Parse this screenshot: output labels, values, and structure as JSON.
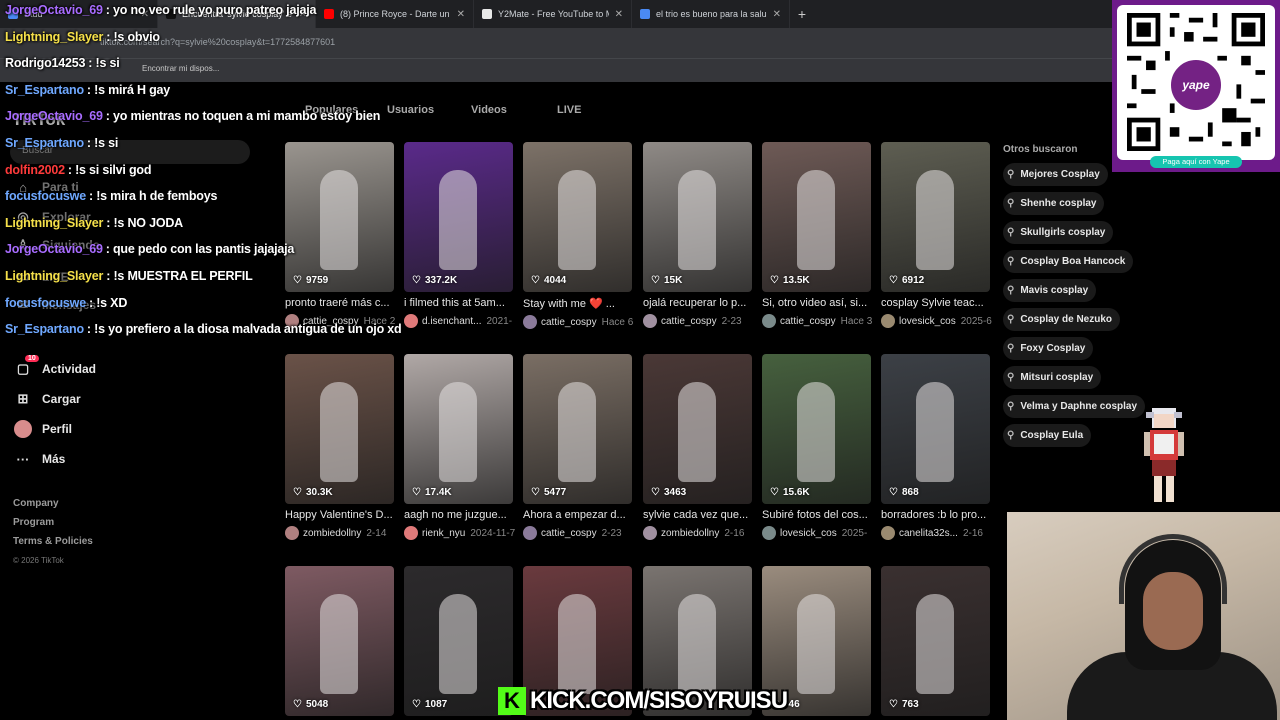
{
  "browser": {
    "tabs": [
      {
        "title": "Stud",
        "color": "#4a8af4",
        "active": false
      },
      {
        "title": "Encuentra 'sylvie cosplay' e",
        "color": "#111111",
        "active": true
      },
      {
        "title": "(8) Prince Royce - Darte un Beso",
        "color": "#ff0000",
        "active": false
      },
      {
        "title": "Y2Mate - Free YouTube to MP3",
        "color": "#e8e8e8",
        "active": false
      },
      {
        "title": "el trio es bueno para la salud -",
        "color": "#4a8af4",
        "active": false
      }
    ],
    "new_tab": "+",
    "url": "tiktok.com/search?q=sylvie%20cosplay&t=1772584877601",
    "bookmarks": [
      "Encontrar mi dispos..."
    ]
  },
  "nav": {
    "logo": "TikTok",
    "search_placeholder": "Buscar",
    "items": [
      {
        "label": "Para ti",
        "icon": "home-icon"
      },
      {
        "label": "Explorar",
        "icon": "compass-icon"
      },
      {
        "label": "Siguiendo",
        "icon": "following-icon"
      },
      {
        "label": "LIVE",
        "icon": "live-icon"
      },
      {
        "label": "Mensajes",
        "icon": "message-icon"
      },
      {
        "label": "Actividad",
        "icon": "activity-icon",
        "badge": "10"
      },
      {
        "label": "Cargar",
        "icon": "upload-icon"
      },
      {
        "label": "Perfil",
        "icon": "avatar"
      },
      {
        "label": "Más",
        "icon": "more-icon"
      }
    ],
    "footer": [
      "Company",
      "Program",
      "Terms & Policies"
    ],
    "copyright": "© 2026 TikTok"
  },
  "search_tabs": [
    "Populares",
    "Usuarios",
    "Videos",
    "LIVE"
  ],
  "videos": [
    {
      "likes": "9759",
      "caption": "pronto traeré más c...",
      "user": "cattie_cospy",
      "date": "Hace 2",
      "tone": "#9a958f"
    },
    {
      "likes": "337.2K",
      "caption": "i filmed this at 5am...",
      "user": "d.isenchant...",
      "date": "2021-",
      "tone": "#5a2a8a"
    },
    {
      "likes": "4044",
      "caption": "Stay with me ❤️ ...",
      "user": "cattie_cospy",
      "date": "Hace 6",
      "tone": "#7d7268"
    },
    {
      "likes": "15K",
      "caption": "ojalá recuperar lo p...",
      "user": "cattie_cospy",
      "date": "2-23",
      "tone": "#8f8a86"
    },
    {
      "likes": "13.5K",
      "caption": "Si, otro video así, si...",
      "user": "cattie_cospy",
      "date": "Hace 3",
      "tone": "#6e5a56"
    },
    {
      "likes": "6912",
      "caption": "cosplay Sylvie teac...",
      "user": "lovesick_cos",
      "date": "2025-6",
      "tone": "#5e5e52"
    },
    {
      "likes": "30.3K",
      "caption": "Happy Valentine's D...",
      "user": "zombiedollny",
      "date": "2-14",
      "tone": "#6a5248"
    },
    {
      "likes": "17.4K",
      "caption": "aagh no me juzgue...",
      "user": "rienk_nyu",
      "date": "2024-11-7",
      "tone": "#b0a8a6"
    },
    {
      "likes": "5477",
      "caption": "Ahora a empezar d...",
      "user": "cattie_cospy",
      "date": "2-23",
      "tone": "#7a6e64"
    },
    {
      "likes": "3463",
      "caption": "sylvie cada vez que...",
      "user": "zombiedollny",
      "date": "2-16",
      "tone": "#4a3836"
    },
    {
      "likes": "15.6K",
      "caption": "Subiré fotos del cos...",
      "user": "lovesick_cos",
      "date": "2025-",
      "tone": "#46603e"
    },
    {
      "likes": "868",
      "caption": "borradores :b lo pro...",
      "user": "canelita32s...",
      "date": "2-16",
      "tone": "#3c4046"
    },
    {
      "likes": "5048",
      "caption": "",
      "user": "",
      "date": "",
      "tone": "#7e5a62"
    },
    {
      "likes": "1087",
      "caption": "",
      "user": "",
      "date": "",
      "tone": "#2c2a2c"
    },
    {
      "likes": "",
      "caption": "",
      "user": "",
      "date": "",
      "tone": "#6a3a3e"
    },
    {
      "likes": "",
      "caption": "",
      "user": "",
      "date": "",
      "tone": "#7a7470"
    },
    {
      "likes": "646",
      "caption": "",
      "user": "",
      "date": "",
      "tone": "#9a8c7e"
    },
    {
      "likes": "763",
      "caption": "",
      "user": "",
      "date": "",
      "tone": "#3a3030"
    }
  ],
  "suggestions": {
    "title": "Otros buscaron",
    "items": [
      "Mejores Cosplay",
      "Shenhe cosplay",
      "Skullgirls cosplay",
      "Cosplay Boa Hancock",
      "Mavis cosplay",
      "Cosplay de Nezuko",
      "Foxy Cosplay",
      "Mitsuri cosplay",
      "Velma y Daphne cosplay",
      "Cosplay Eula"
    ]
  },
  "chat": [
    {
      "user": "JorgeOctavio_69",
      "color": "#a86cff",
      "text": ": yo no veo rule yo puro patreo jajaja"
    },
    {
      "user": "Lightning_Slayer",
      "color": "#f5e04a",
      "text": ": !s obvio"
    },
    {
      "user": "Rodrigo14253",
      "color": "#ffffff",
      "text": ": !s si"
    },
    {
      "user": "Sr_Espartano",
      "color": "#6fa8ff",
      "text": ": !s mirá H gay"
    },
    {
      "user": "JorgeOctavio_69",
      "color": "#a86cff",
      "text": ": yo mientras no toquen a mi mambo estoy bien"
    },
    {
      "user": "Sr_Espartano",
      "color": "#6fa8ff",
      "text": ": !s si"
    },
    {
      "user": "dolfin2002",
      "color": "#ff3b3b",
      "text": ": !s si silvi god"
    },
    {
      "user": "focusfocuswe",
      "color": "#6fa8ff",
      "text": ": !s mira h de femboys"
    },
    {
      "user": "Lightning_Slayer",
      "color": "#f5e04a",
      "text": ": !s NO JODA"
    },
    {
      "user": "JorgeOctavio_69",
      "color": "#a86cff",
      "text": ": que pedo con las pantis jajajaja"
    },
    {
      "user": "Lightning_Slayer",
      "color": "#f5e04a",
      "text": ": !s MUESTRA EL PERFIL"
    },
    {
      "user": "focusfocuswe",
      "color": "#6fa8ff",
      "text": ": !s XD"
    },
    {
      "user": "Sr_Espartano",
      "color": "#6fa8ff",
      "text": ": !s yo prefiero a la diosa malvada antigua de un ojo xd"
    }
  ],
  "yape": {
    "logo": "yape",
    "caption": "Paga aquí con Yape"
  },
  "kick": {
    "icon": "K",
    "text": "KICK.COM/SISOYRUISU"
  }
}
